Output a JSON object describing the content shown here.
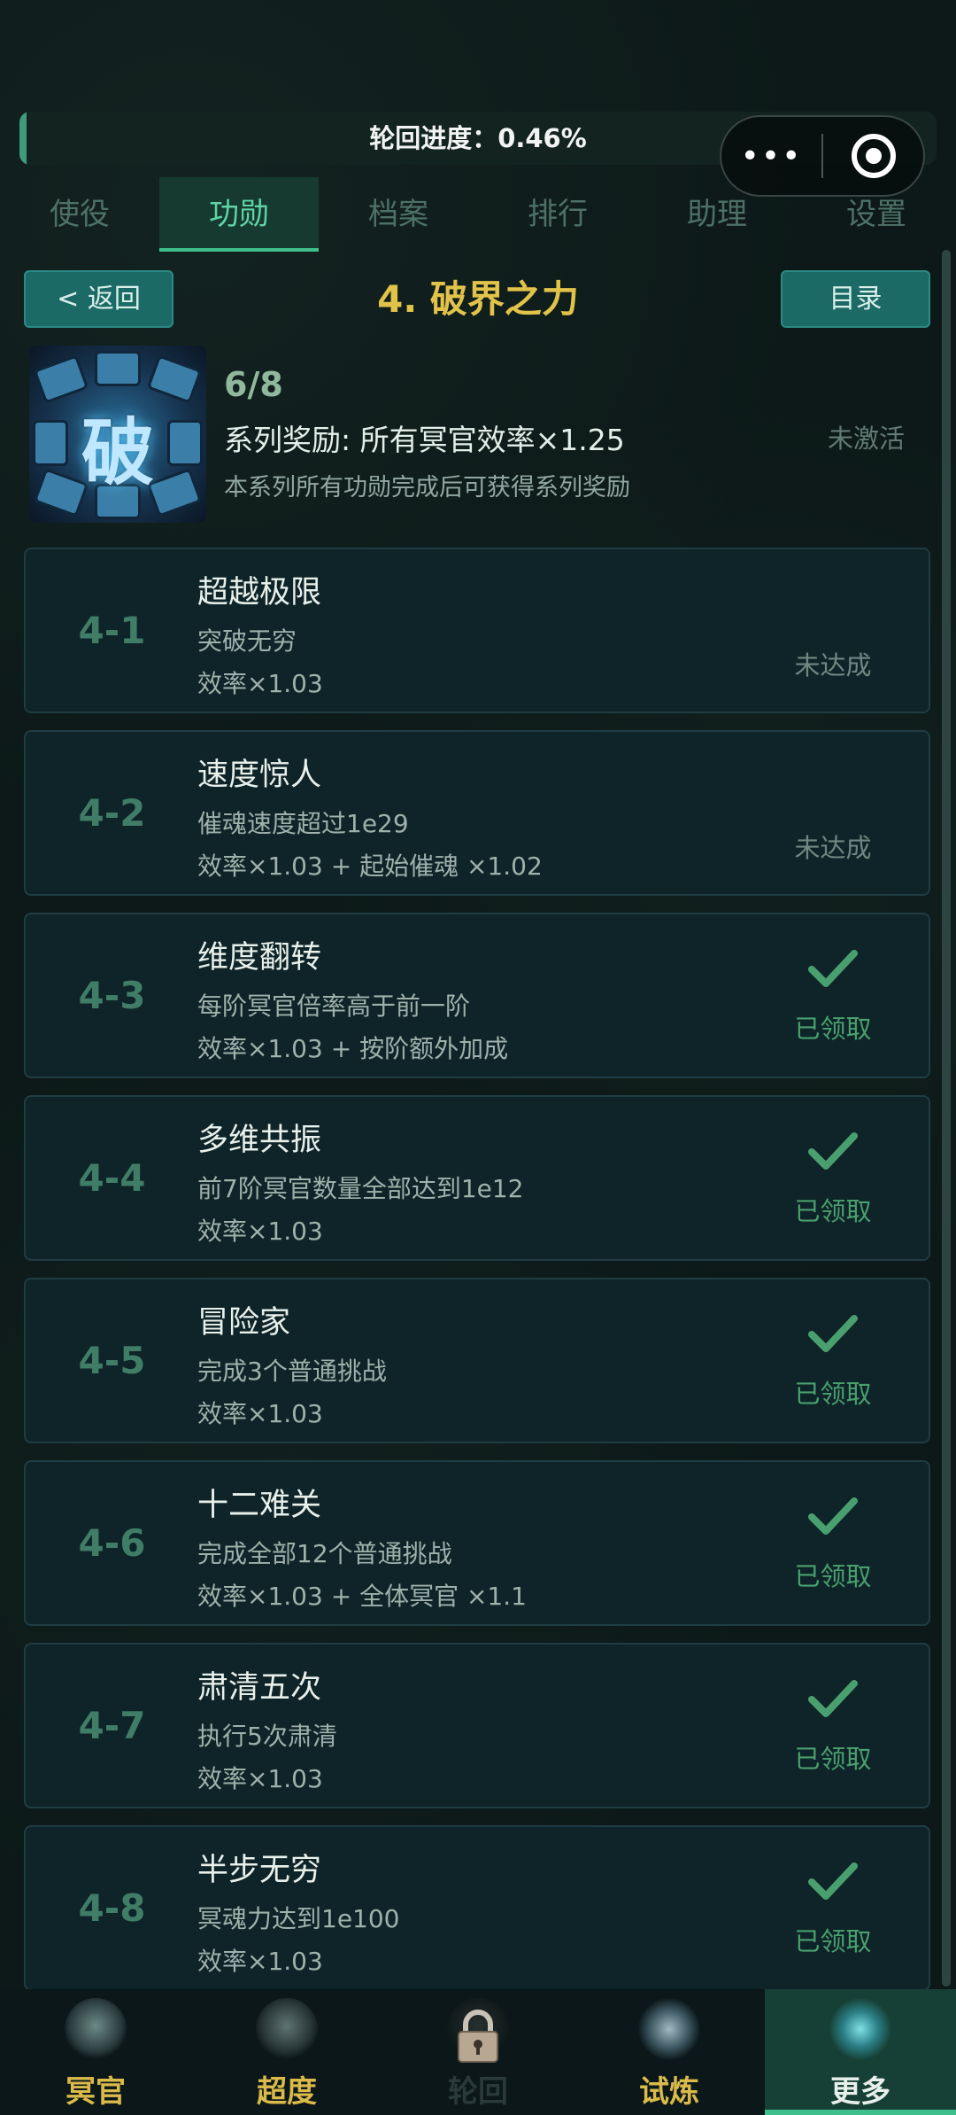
{
  "colors": {
    "accent": "#3fbf8c",
    "title_gold": "#e2c34a",
    "done_green": "#49a06e",
    "button_teal": "#1c6a66"
  },
  "progress": {
    "label": "轮回进度：0.46%",
    "fraction": 0.0046
  },
  "capsule": {
    "more_icon": "more-dots-icon",
    "close_icon": "target-icon"
  },
  "tabs": [
    {
      "label": "使役",
      "active": false
    },
    {
      "label": "功勋",
      "active": true
    },
    {
      "label": "档案",
      "active": false
    },
    {
      "label": "排行",
      "active": false
    },
    {
      "label": "助理",
      "active": false
    },
    {
      "label": "设置",
      "active": false
    }
  ],
  "header": {
    "back_label": "< 返回",
    "title": "4. 破界之力",
    "menu_label": "目录"
  },
  "series": {
    "badge_glyph": "破",
    "progress": "6/8",
    "reward": "系列奖励: 所有冥官效率×1.25",
    "description": "本系列所有功勋完成后可获得系列奖励",
    "status": "未激活"
  },
  "achievements": [
    {
      "id": "4-1",
      "name": "超越极限",
      "condition": "突破无穷",
      "reward": "效率×1.03",
      "status": "未达成",
      "claimed": false
    },
    {
      "id": "4-2",
      "name": "速度惊人",
      "condition": "催魂速度超过1e29",
      "reward": "效率×1.03 + 起始催魂 ×1.02",
      "status": "未达成",
      "claimed": false
    },
    {
      "id": "4-3",
      "name": "维度翻转",
      "condition": "每阶冥官倍率高于前一阶",
      "reward": "效率×1.03 + 按阶额外加成",
      "status": "已领取",
      "claimed": true
    },
    {
      "id": "4-4",
      "name": "多维共振",
      "condition": "前7阶冥官数量全部达到1e12",
      "reward": "效率×1.03",
      "status": "已领取",
      "claimed": true
    },
    {
      "id": "4-5",
      "name": "冒险家",
      "condition": "完成3个普通挑战",
      "reward": "效率×1.03",
      "status": "已领取",
      "claimed": true
    },
    {
      "id": "4-6",
      "name": "十二难关",
      "condition": "完成全部12个普通挑战",
      "reward": "效率×1.03 + 全体冥官 ×1.1",
      "status": "已领取",
      "claimed": true
    },
    {
      "id": "4-7",
      "name": "肃清五次",
      "condition": "执行5次肃清",
      "reward": "效率×1.03",
      "status": "已领取",
      "claimed": true
    },
    {
      "id": "4-8",
      "name": "半步无穷",
      "condition": "冥魂力达到1e100",
      "reward": "效率×1.03",
      "status": "已领取",
      "claimed": true
    }
  ],
  "bottom_nav": [
    {
      "label": "冥官",
      "icon": "ghost-officer-icon",
      "state": "gold"
    },
    {
      "label": "超度",
      "icon": "pagoda-icon",
      "state": "gold"
    },
    {
      "label": "轮回",
      "icon": "lock-icon",
      "state": "locked"
    },
    {
      "label": "试炼",
      "icon": "flame-icon",
      "state": "gold"
    },
    {
      "label": "更多",
      "icon": "spade-emblem-icon",
      "state": "active"
    }
  ]
}
